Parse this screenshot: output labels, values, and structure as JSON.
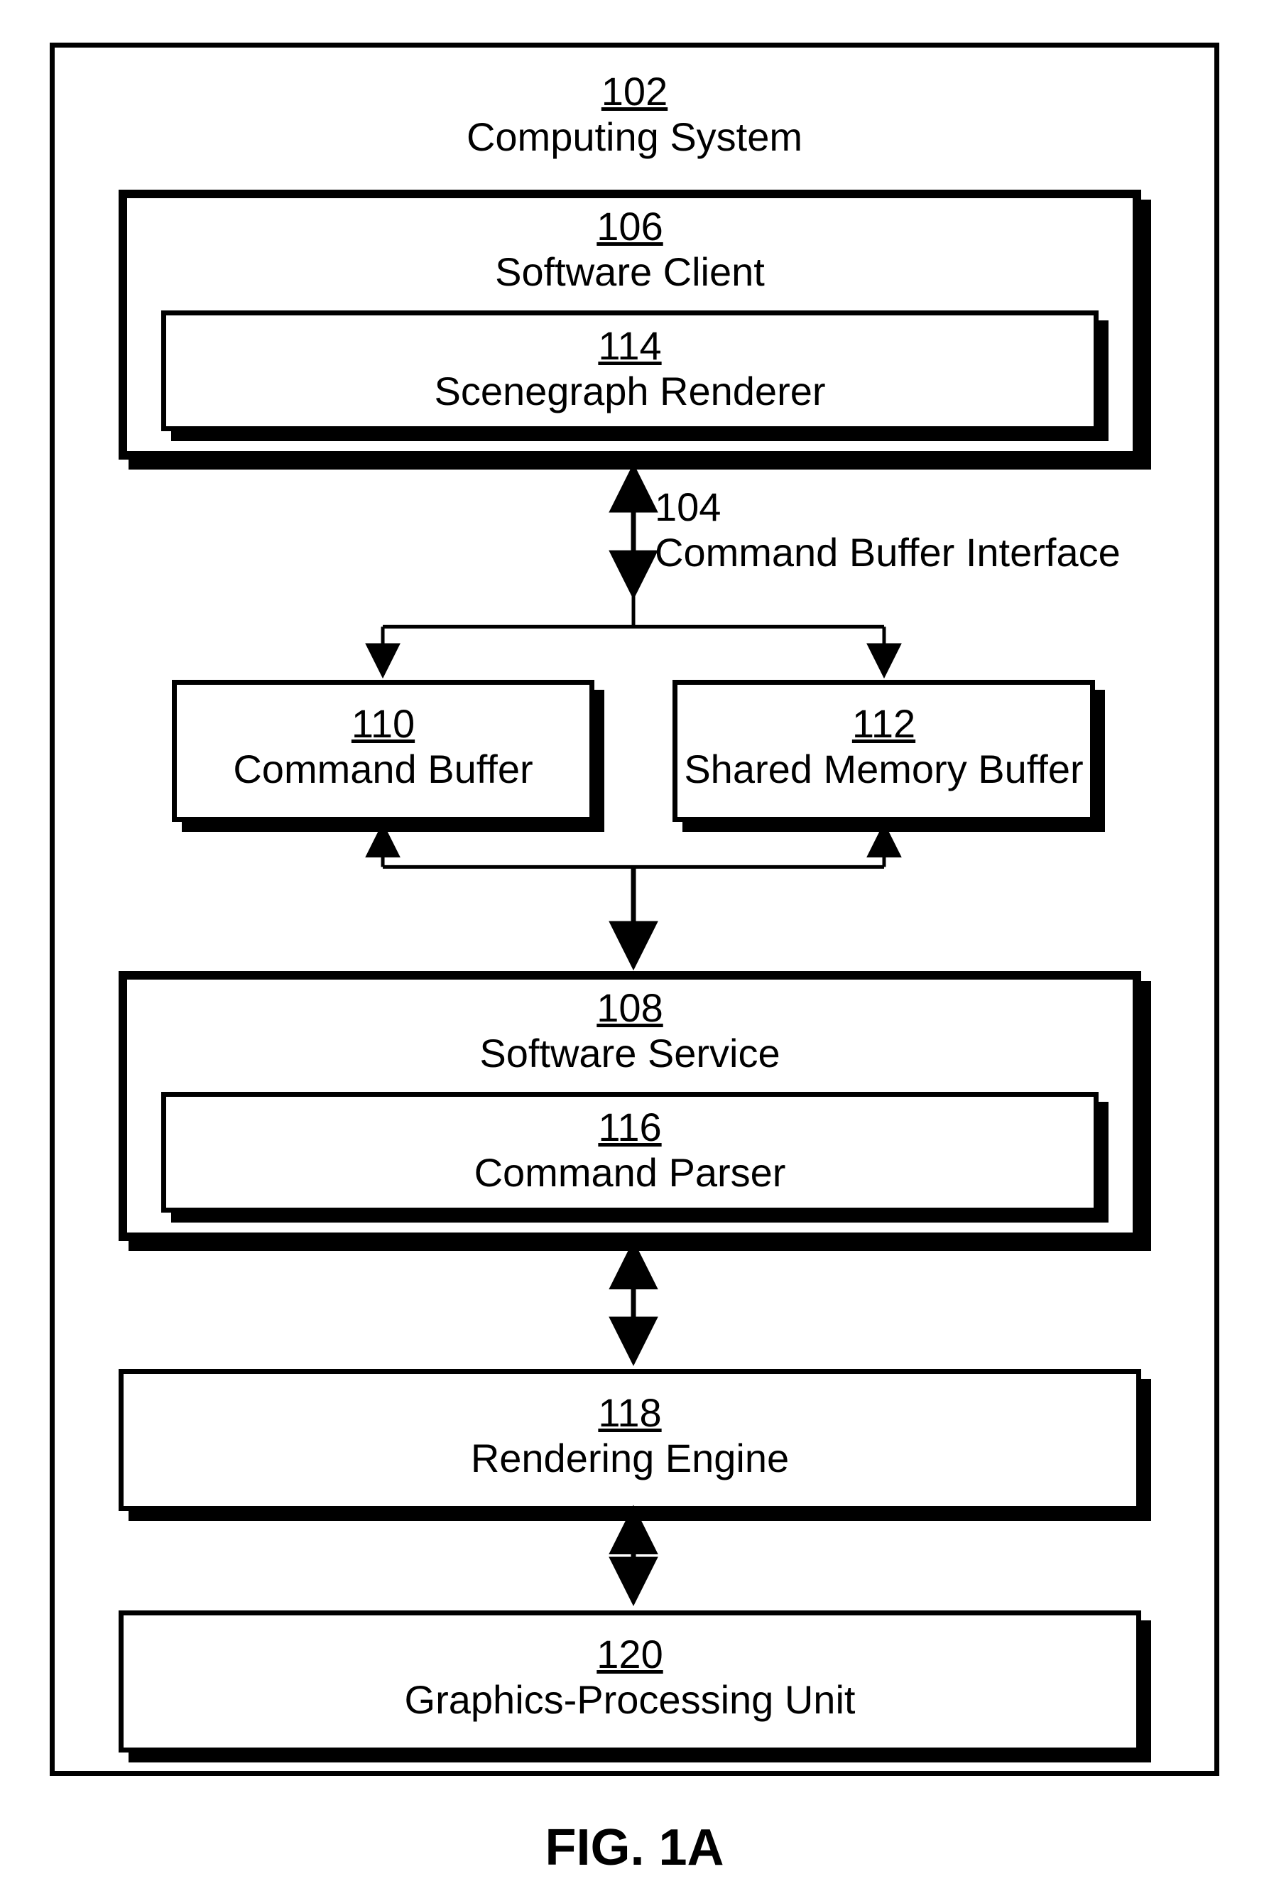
{
  "figure_label": "FIG. 1A",
  "diagram": {
    "system": {
      "num": "102",
      "name": "Computing System"
    },
    "client": {
      "num": "106",
      "name": "Software Client"
    },
    "scenegraph": {
      "num": "114",
      "name": "Scenegraph Renderer"
    },
    "cbi": {
      "num": "104",
      "name": "Command Buffer Interface"
    },
    "cmdbuf": {
      "num": "110",
      "name": "Command Buffer"
    },
    "shmbuf": {
      "num": "112",
      "name": "Shared Memory Buffer"
    },
    "service": {
      "num": "108",
      "name": "Software Service"
    },
    "parser": {
      "num": "116",
      "name": "Command Parser"
    },
    "engine": {
      "num": "118",
      "name": "Rendering Engine"
    },
    "gpu": {
      "num": "120",
      "name": "Graphics-Processing Unit"
    }
  }
}
